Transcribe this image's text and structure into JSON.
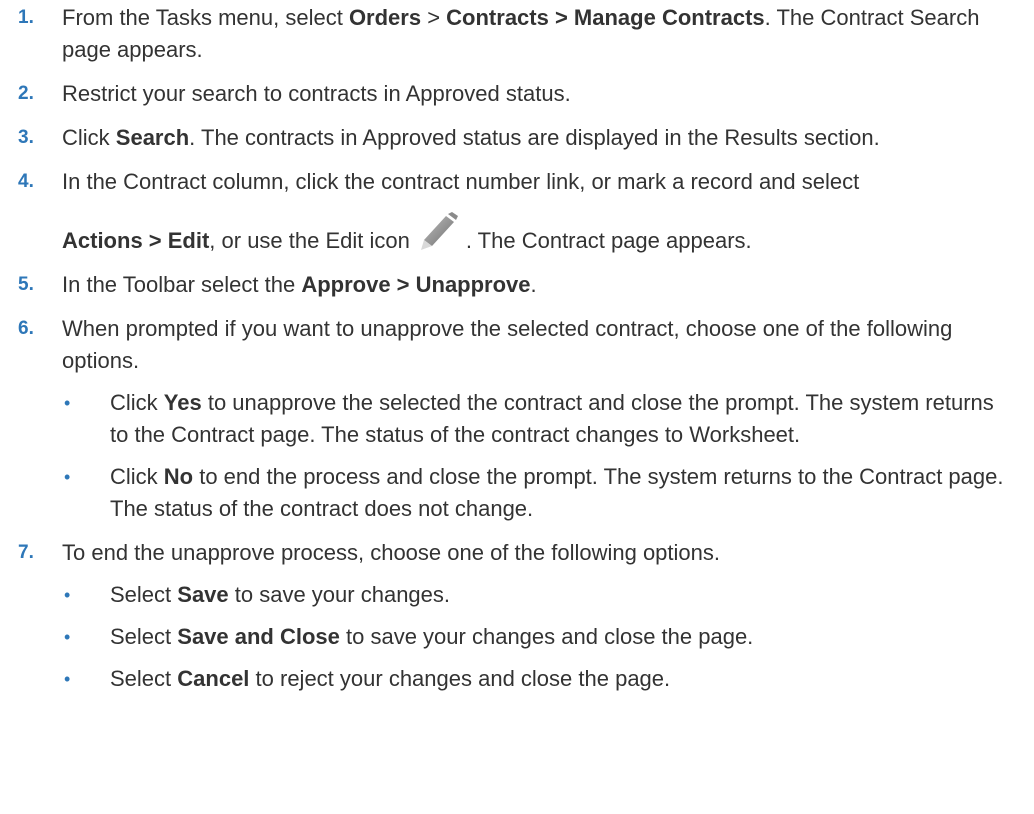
{
  "steps": [
    {
      "num": "1.",
      "parts": [
        "From the Tasks menu, select ",
        "Orders",
        " > ",
        "Contracts > Manage Contracts",
        ". The Contract Search page appears."
      ]
    },
    {
      "num": "2.",
      "text": "Restrict your search to contracts in Approved status."
    },
    {
      "num": "3.",
      "parts": [
        "Click ",
        "Search",
        ". The contracts in Approved status are displayed in the Results section."
      ]
    },
    {
      "num": "4.",
      "line1": "In the Contract column, click the contract number link, or mark a record and select",
      "bold": "Actions > Edit",
      "mid": ", or use the Edit icon",
      "tail": ". The Contract page appears.",
      "icon": "pencil-icon"
    },
    {
      "num": "5.",
      "parts": [
        "In the Toolbar select the ",
        "Approve > Unapprove",
        "."
      ]
    },
    {
      "num": "6.",
      "text": "When prompted if you want to unapprove the selected contract, choose one of the following options.",
      "subs": [
        {
          "pre": "Click ",
          "bold": "Yes",
          "post": " to unapprove the selected the contract and close the prompt. The system returns to the Contract page. The status of the contract changes to Worksheet."
        },
        {
          "pre": "Click ",
          "bold": "No",
          "post": " to end the process and close the prompt. The system returns to the Contract page. The status of the contract does not change."
        }
      ]
    },
    {
      "num": "7.",
      "text": "To end the unapprove process, choose one of the following options.",
      "subs": [
        {
          "pre": "Select ",
          "bold": "Save",
          "post": " to save your changes."
        },
        {
          "pre": "Select ",
          "bold": "Save and Close",
          "post": " to save your changes and close the page."
        },
        {
          "pre": "Select ",
          "bold": "Cancel",
          "post": " to reject your changes and close the page."
        }
      ]
    }
  ],
  "bullet_char": "•",
  "colors": {
    "accent": "#2e77b8",
    "text": "#333333"
  }
}
